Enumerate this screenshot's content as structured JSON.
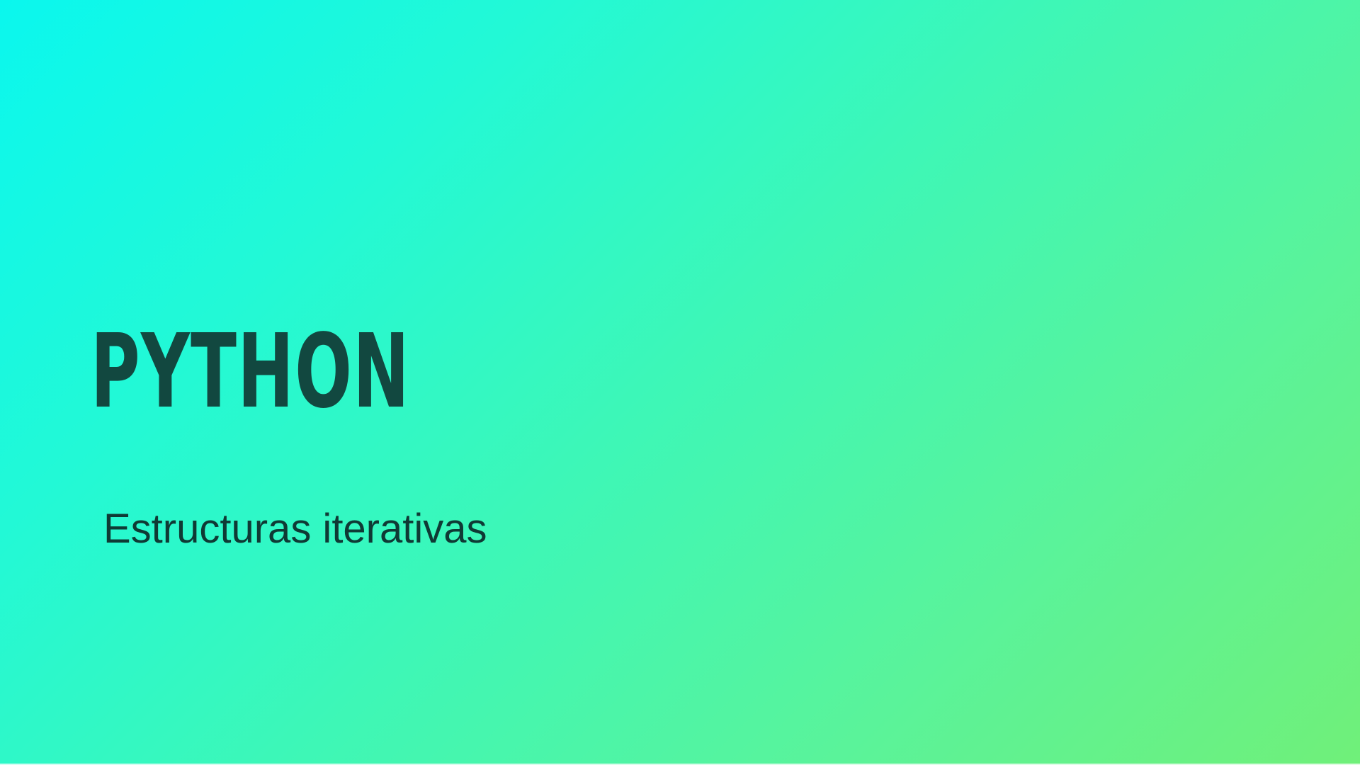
{
  "slide": {
    "title": "PYTHON",
    "subtitle": "Estructuras iterativas"
  },
  "colors": {
    "gradient_start": "#0af7ee",
    "gradient_end": "#70f079",
    "title_text": "#124840",
    "subtitle_text": "#0f3a35"
  }
}
